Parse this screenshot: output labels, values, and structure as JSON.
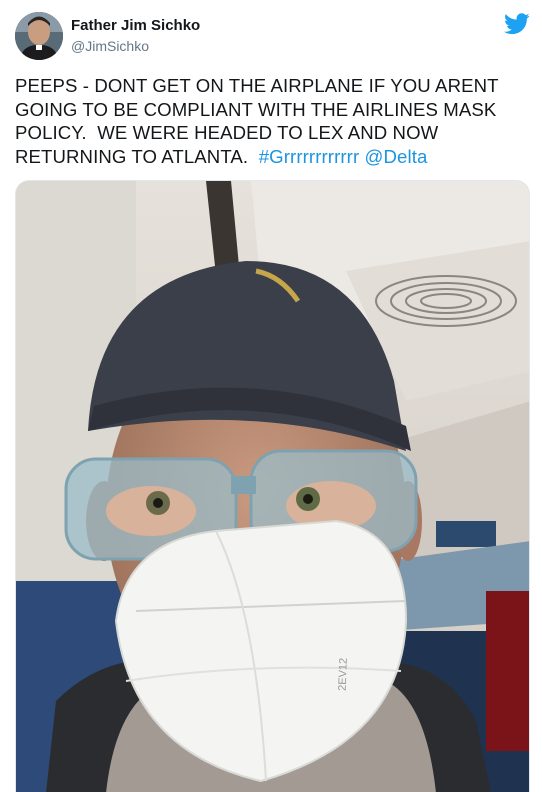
{
  "tweet": {
    "author_name": "Father Jim Sichko",
    "author_handle": "@JimSichko",
    "text_lines": [
      "PEEPS - DONT GET ON THE AIRPLANE IF YOU ARENT",
      "GOING TO BE COMPLIANT WITH THE AIRLINES MASK",
      "POLICY.  WE WERE HEADED TO LEX AND NOW",
      "RETURNING TO ATLANTA."
    ],
    "hashtag": "#Grrrrrrrrrrrr",
    "mention": "@Delta",
    "mask_print": "2EV12"
  },
  "icons": {
    "brand": "twitter-bird-icon",
    "brand_color": "#1da1f2",
    "link_color": "#1b95e0"
  }
}
